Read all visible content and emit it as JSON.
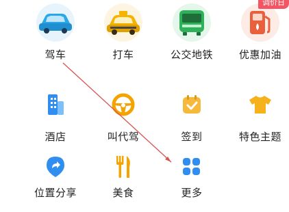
{
  "grid": {
    "items": [
      {
        "label": "驾车",
        "icon": "car-icon"
      },
      {
        "label": "打车",
        "icon": "taxi-icon"
      },
      {
        "label": "公交地铁",
        "icon": "bus-icon"
      },
      {
        "label": "优惠加油",
        "icon": "fuel-pump-icon",
        "badge": "调价日"
      },
      {
        "label": "酒店",
        "icon": "hotel-building-icon"
      },
      {
        "label": "叫代驾",
        "icon": "steering-wheel-icon"
      },
      {
        "label": "签到",
        "icon": "calendar-check-icon"
      },
      {
        "label": "特色主题",
        "icon": "tshirt-icon"
      },
      {
        "label": "位置分享",
        "icon": "share-location-icon"
      },
      {
        "label": "美食",
        "icon": "fork-knife-icon"
      },
      {
        "label": "更多",
        "icon": "more-grid-icon"
      }
    ]
  },
  "colors": {
    "car": "#2aa7e8",
    "taxi": "#f4b400",
    "bus": "#2eb15a",
    "fuel": "#e8603c",
    "badge": "#f45565",
    "blue": "#2f8ef0",
    "arrow": "#d9534f"
  }
}
